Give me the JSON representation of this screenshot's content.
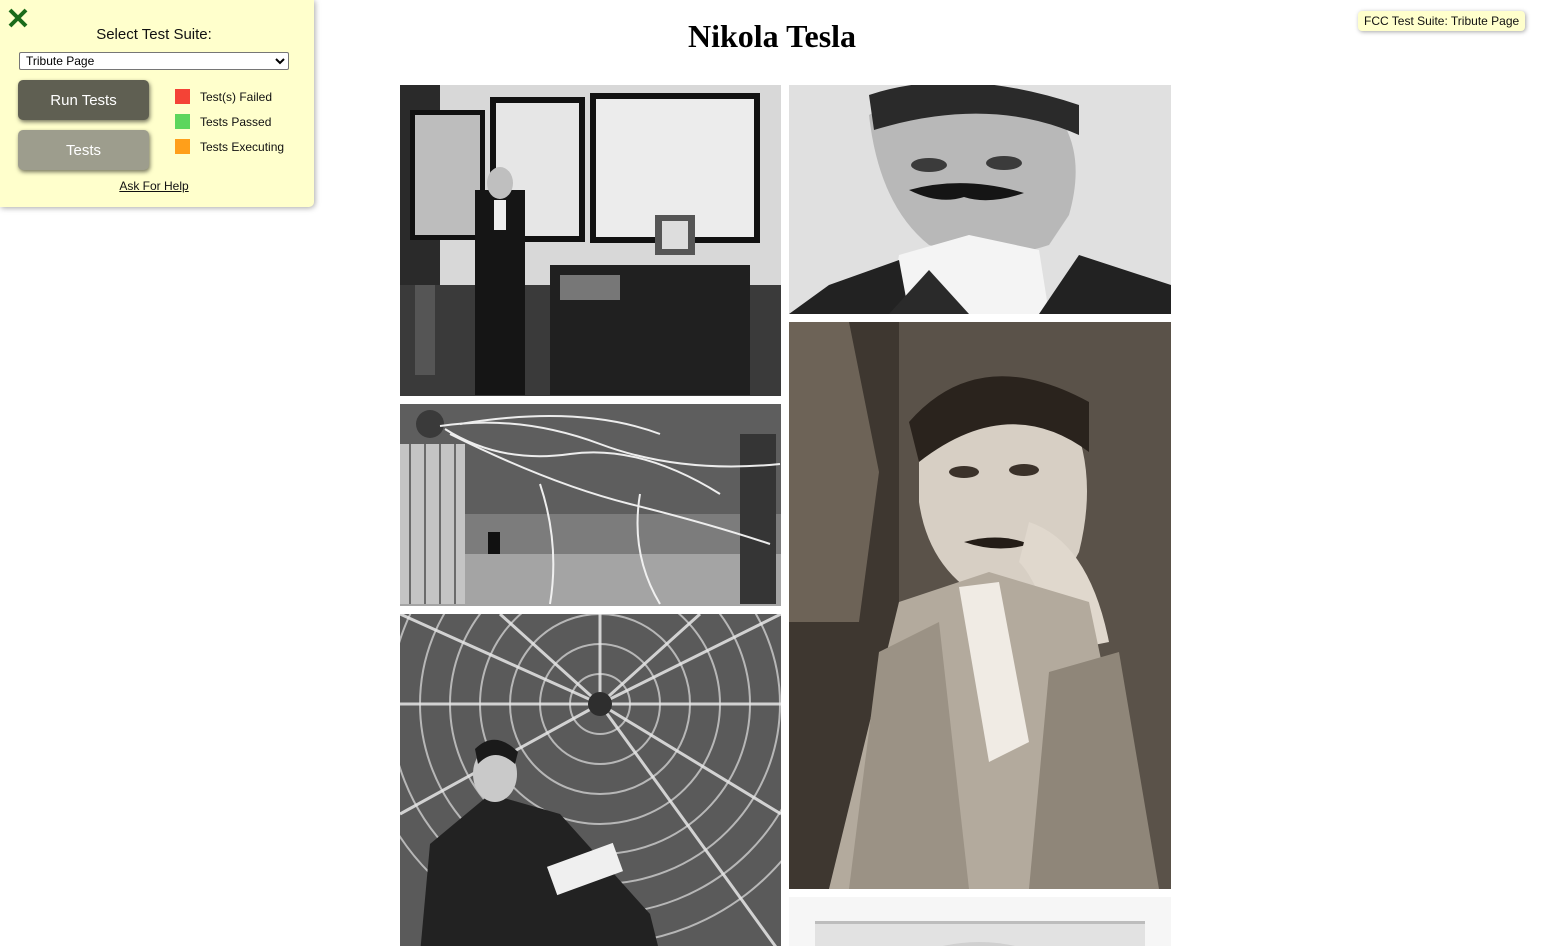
{
  "fcc_panel": {
    "suite_label": "Select Test Suite:",
    "suite_selected": "Tribute Page",
    "run_tests_label": "Run Tests",
    "tests_label": "Tests",
    "legend": [
      {
        "label": "Test(s) Failed",
        "color": "#f44336"
      },
      {
        "label": "Tests Passed",
        "color": "#5dd65d"
      },
      {
        "label": "Tests Executing",
        "color": "#ff9f1a"
      }
    ],
    "help_label": "Ask For Help",
    "close_icon_color": "#1a6b1a"
  },
  "suite_tag": "FCC Test Suite: Tribute Page",
  "page": {
    "title": "Nikola Tesla"
  },
  "photos": [
    {
      "name": "tesla-laboratory-photo",
      "icon": "photo-image"
    },
    {
      "name": "tesla-sketch-portrait-photo",
      "icon": "photo-image"
    },
    {
      "name": "tesla-lightning-coil-photo",
      "icon": "photo-image"
    },
    {
      "name": "tesla-portrait-hand-photo",
      "icon": "photo-image"
    },
    {
      "name": "tesla-reading-coil-photo",
      "icon": "photo-image"
    },
    {
      "name": "tesla-additional-photo",
      "icon": "photo-image"
    }
  ]
}
